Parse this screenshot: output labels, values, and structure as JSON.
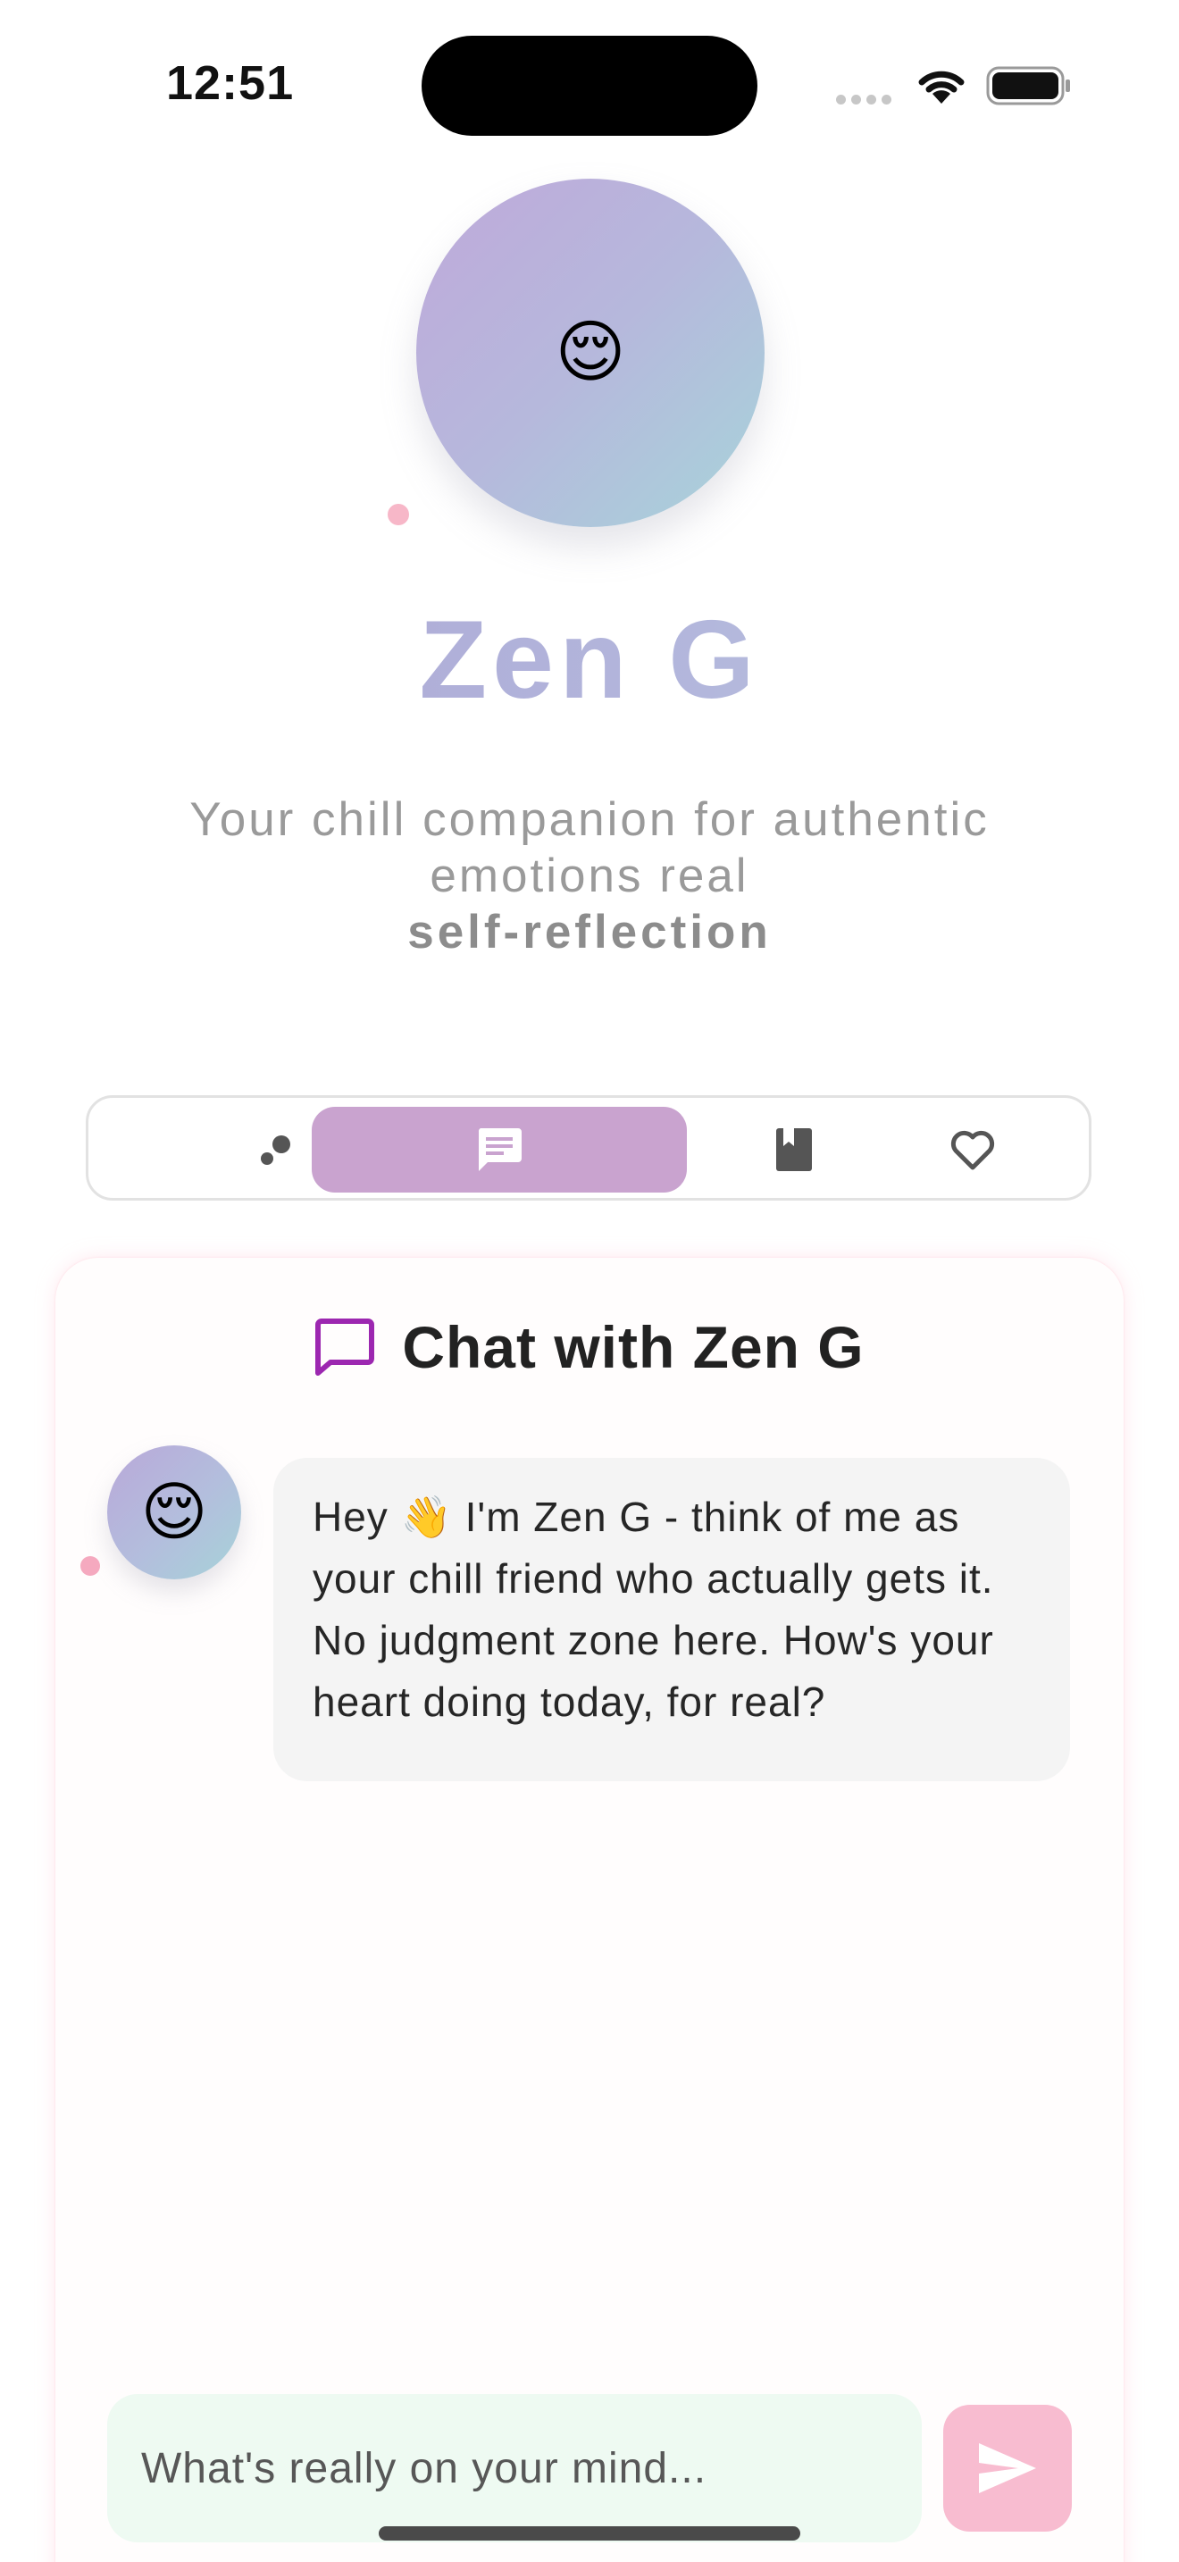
{
  "status_bar": {
    "time": "12:51"
  },
  "hero": {
    "avatar_emoji": "😌",
    "title": "Zen G",
    "tagline": "Your chill companion for authentic emotions real",
    "tagline_emphasis": "self-reflection"
  },
  "tabs": [
    {
      "name": "insights",
      "icon": "bubbles-icon",
      "active": false
    },
    {
      "name": "chat",
      "icon": "chat-icon",
      "active": true
    },
    {
      "name": "journal",
      "icon": "book-icon",
      "active": false
    },
    {
      "name": "favorites",
      "icon": "heart-icon",
      "active": false
    }
  ],
  "chat": {
    "title": "Chat with Zen G",
    "messages": [
      {
        "sender": "Zen G",
        "avatar_emoji": "😌",
        "text": "Hey 👋 I'm Zen G - think of me as your chill friend who actually gets it. No judgment zone here. How's your heart doing today, for real?"
      }
    ],
    "input": {
      "placeholder": "What's really on your mind...",
      "value": ""
    }
  },
  "colors": {
    "accent_purple": "#c9a3cf",
    "chat_icon": "#9c27b0",
    "send_button": "#f8bcd0",
    "input_background": "#eefaf2"
  }
}
